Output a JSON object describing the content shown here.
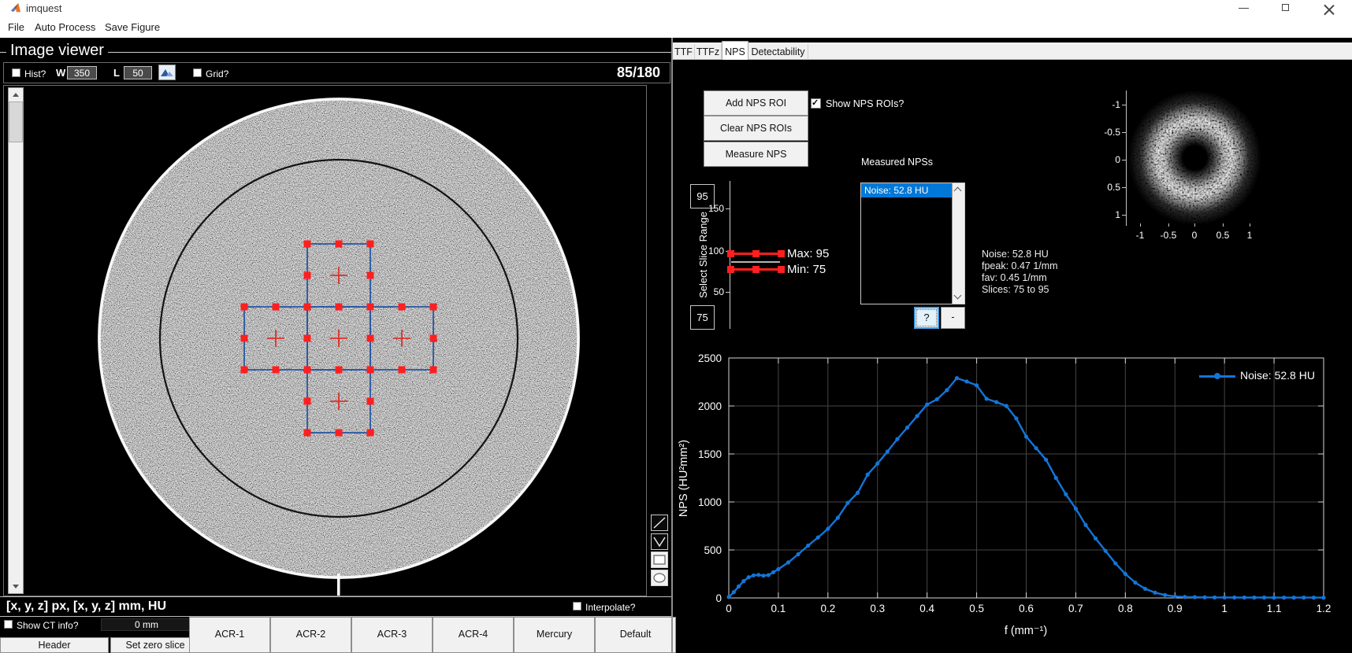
{
  "window": {
    "title": "imquest"
  },
  "menu": {
    "items": [
      "File",
      "Auto Process",
      "Save Figure"
    ]
  },
  "image_viewer": {
    "panel_title": "Image viewer",
    "hist_label": "Hist?",
    "w_label": "W",
    "w_value": "350",
    "l_label": "L",
    "l_value": "50",
    "grid_label": "Grid?",
    "slice_indicator": "85/180",
    "status_text": "[x, y, z] px, [x, y, z] mm, HU",
    "interpolate_label": "Interpolate?",
    "show_ct_info_label": "Show CT info?",
    "zero_offset": "0 mm",
    "header_button": "Header",
    "set_zero_button": "Set zero slice",
    "presets": [
      "ACR-1",
      "ACR-2",
      "ACR-3",
      "ACR-4",
      "Mercury",
      "Default"
    ]
  },
  "right_panel": {
    "tabs": [
      {
        "label": "TTF",
        "active": false
      },
      {
        "label": "TTFz",
        "active": false
      },
      {
        "label": "NPS",
        "active": true
      },
      {
        "label": "Detectability",
        "active": false
      }
    ],
    "roi_buttons": [
      "Add NPS ROI",
      "Clear NPS ROIs",
      "Measure NPS"
    ],
    "show_nps_rois_label": "Show NPS ROIs?",
    "show_nps_rois_checked": true,
    "measured_label": "Measured NPSs",
    "measured_items": [
      "Noise: 52.8 HU"
    ],
    "selected_index": 0,
    "help_button": "?",
    "remove_button": "-",
    "stats": [
      "Noise: 52.8 HU",
      "fpeak: 0.47 1/mm",
      "fav: 0.45 1/mm",
      "Slices: 75 to 95"
    ],
    "slider": {
      "top_value": "95",
      "bottom_value": "75",
      "axis_label": "Select Slice Range",
      "ticks": [
        "150",
        "100",
        "50"
      ],
      "max_label": "Max: 95",
      "min_label": "Min: 75"
    },
    "nps2d": {
      "yticks": [
        "-1",
        "-0.5",
        "0",
        "0.5",
        "1"
      ],
      "xticks": [
        "-1",
        "-0.5",
        "0",
        "0.5",
        "1"
      ]
    }
  },
  "colors": {
    "curve_blue": "#1375d8",
    "roi_red": "#ff1f1f",
    "roi_line_blue": "#2857a4",
    "selection_blue": "#0078d7"
  },
  "chart_data": {
    "type": "line",
    "title": "",
    "xlabel": "f (mm⁻¹)",
    "ylabel": "NPS (HU²mm²)",
    "xlim": [
      0,
      1.2
    ],
    "ylim": [
      0,
      2500
    ],
    "xticks": [
      0,
      0.1,
      0.2,
      0.3,
      0.4,
      0.5,
      0.6,
      0.7,
      0.8,
      0.9,
      1,
      1.1,
      1.2
    ],
    "yticks": [
      0,
      500,
      1000,
      1500,
      2000,
      2500
    ],
    "grid": true,
    "legend": {
      "position": "northeast"
    },
    "series": [
      {
        "name": "Noise: 52.8 HU",
        "color": "#1375d8",
        "x": [
          0,
          0.01,
          0.02,
          0.03,
          0.04,
          0.05,
          0.06,
          0.07,
          0.08,
          0.09,
          0.1,
          0.12,
          0.14,
          0.16,
          0.18,
          0.2,
          0.22,
          0.24,
          0.26,
          0.28,
          0.3,
          0.32,
          0.34,
          0.36,
          0.38,
          0.4,
          0.42,
          0.44,
          0.46,
          0.48,
          0.5,
          0.52,
          0.54,
          0.56,
          0.58,
          0.6,
          0.62,
          0.64,
          0.66,
          0.68,
          0.7,
          0.72,
          0.74,
          0.76,
          0.78,
          0.8,
          0.82,
          0.84,
          0.86,
          0.88,
          0.9,
          0.92,
          0.94,
          0.96,
          0.98,
          1.0,
          1.02,
          1.04,
          1.06,
          1.08,
          1.1,
          1.12,
          1.14,
          1.16,
          1.18,
          1.2
        ],
        "y": [
          10,
          60,
          120,
          175,
          215,
          235,
          240,
          232,
          238,
          268,
          300,
          370,
          455,
          545,
          630,
          720,
          835,
          990,
          1095,
          1285,
          1400,
          1525,
          1655,
          1775,
          1895,
          2015,
          2070,
          2165,
          2290,
          2255,
          2215,
          2075,
          2040,
          2000,
          1870,
          1680,
          1560,
          1440,
          1250,
          1080,
          930,
          760,
          620,
          490,
          360,
          250,
          160,
          95,
          55,
          30,
          15,
          10,
          8,
          6,
          5,
          5,
          4,
          4,
          4,
          4,
          3,
          3,
          3,
          3,
          3,
          3
        ]
      }
    ]
  }
}
